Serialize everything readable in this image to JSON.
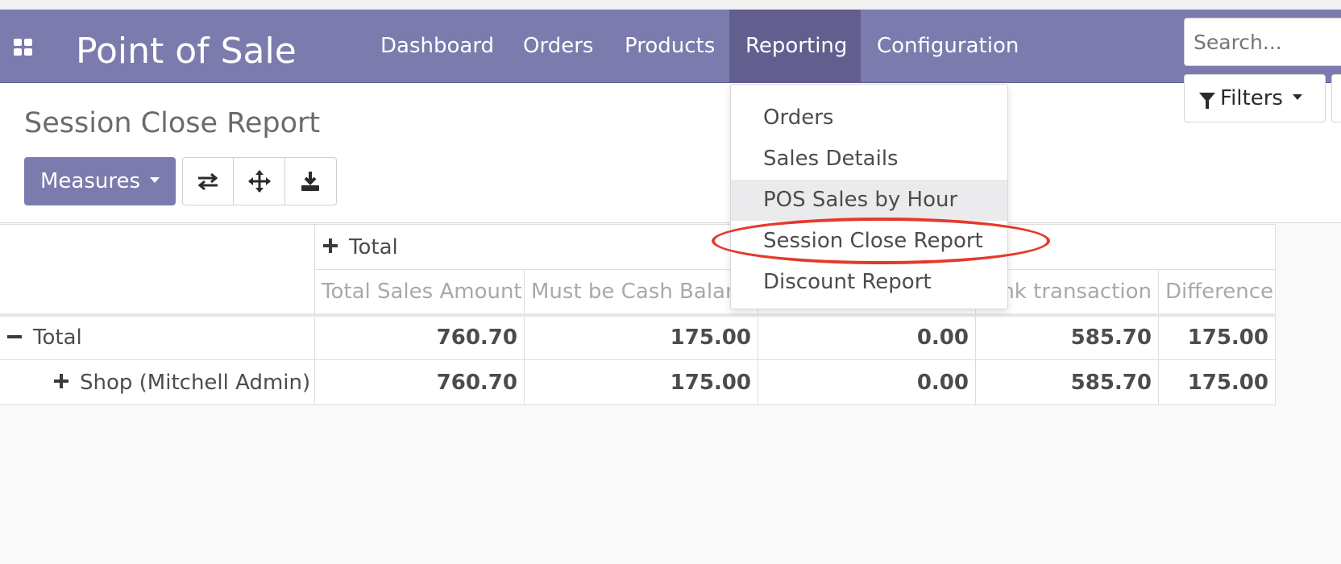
{
  "navbar": {
    "app_title": "Point of Sale",
    "menu": [
      "Dashboard",
      "Orders",
      "Products",
      "Reporting",
      "Configuration"
    ],
    "active": "Reporting",
    "color": "#7c7bad"
  },
  "control_panel": {
    "title": "Session Close Report",
    "measures_label": "Measures",
    "search_placeholder": "Search...",
    "filters_label": "Filters",
    "tool_icons": [
      "swap-axis-icon",
      "expand-all-icon",
      "download-icon"
    ]
  },
  "dropdown": {
    "items": [
      "Orders",
      "Sales Details",
      "POS Sales by Hour",
      "Session Close Report",
      "Discount Report"
    ],
    "highlighted": "POS Sales by Hour",
    "circled": "Session Close Report",
    "annotation_color": "#e43a2b"
  },
  "pivot": {
    "col_group": "Total",
    "measures": [
      "Total Sales Amount",
      "Must be Cash Balan",
      "",
      "nk transaction",
      "Difference"
    ],
    "rows": [
      {
        "label": "Total",
        "values": [
          "760.70",
          "175.00",
          "0.00",
          "585.70",
          "175.00"
        ]
      },
      {
        "label": "Shop (Mitchell Admin)",
        "values": [
          "760.70",
          "175.00",
          "0.00",
          "585.70",
          "175.00"
        ]
      }
    ]
  }
}
